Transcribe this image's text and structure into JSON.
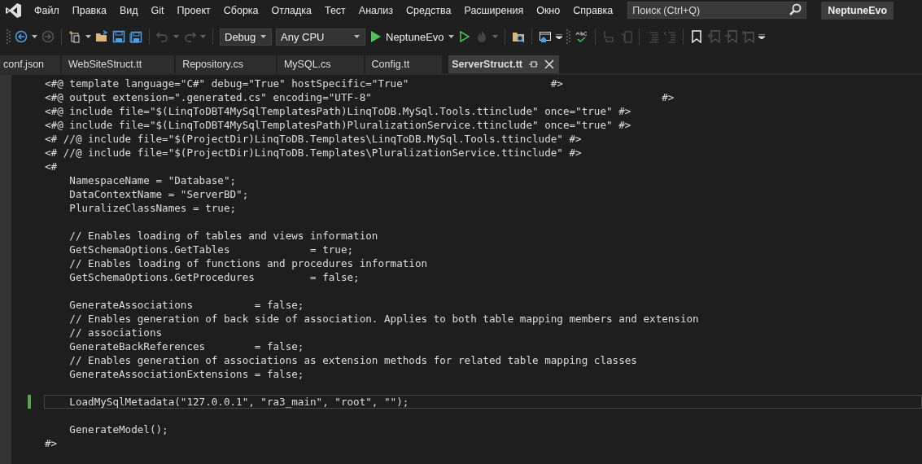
{
  "menu_bar": {
    "items": [
      "Файл",
      "Правка",
      "Вид",
      "Git",
      "Проект",
      "Сборка",
      "Отладка",
      "Тест",
      "Анализ",
      "Средства",
      "Расширения",
      "Окно",
      "Справка"
    ],
    "search": {
      "placeholder": "Поиск (Ctrl+Q)"
    },
    "solution_name": "NeptuneEvo"
  },
  "toolbar": {
    "configuration": "Debug",
    "platform": "Any CPU",
    "start_target": "NeptuneEvo"
  },
  "tabs": [
    {
      "label": "conf.json",
      "selected": false
    },
    {
      "label": "WebSiteStruct.tt",
      "selected": false
    },
    {
      "label": "Repository.cs",
      "selected": false
    },
    {
      "label": "MySQL.cs",
      "selected": false
    },
    {
      "label": "Config.tt",
      "selected": false
    },
    {
      "label": "ServerStruct.tt",
      "selected": true
    }
  ],
  "editor": {
    "lines": [
      {
        "kind": "code",
        "text": "<#@ template language=\"C#\" debug=\"True\" hostSpecific=\"True\"                       #>",
        "changed": false,
        "current": false
      },
      {
        "kind": "code",
        "text": "<#@ output extension=\".generated.cs\" encoding=\"UTF-8\"                                               #>",
        "changed": false,
        "current": false
      },
      {
        "kind": "code",
        "text": "<#@ include file=\"$(LinqToDBT4MySqlTemplatesPath)LinqToDB.MySql.Tools.ttinclude\" once=\"true\" #>",
        "changed": false,
        "current": false
      },
      {
        "kind": "code",
        "text": "<#@ include file=\"$(LinqToDBT4MySqlTemplatesPath)PluralizationService.ttinclude\" once=\"true\" #>",
        "changed": false,
        "current": false
      },
      {
        "kind": "code",
        "text": "<# //@ include file=\"$(ProjectDir)LinqToDB.Templates\\LinqToDB.MySql.Tools.ttinclude\" #>",
        "changed": false,
        "current": false
      },
      {
        "kind": "code",
        "text": "<# //@ include file=\"$(ProjectDir)LinqToDB.Templates\\PluralizationService.ttinclude\" #>",
        "changed": false,
        "current": false
      },
      {
        "kind": "code",
        "text": "<#",
        "changed": false,
        "current": false
      },
      {
        "kind": "code",
        "text": "    NamespaceName = \"Database\";",
        "changed": false,
        "current": false
      },
      {
        "kind": "code",
        "text": "    DataContextName = \"ServerBD\";",
        "changed": false,
        "current": false
      },
      {
        "kind": "code",
        "text": "    PluralizeClassNames = true;",
        "changed": false,
        "current": false
      },
      {
        "kind": "blank",
        "changed": false,
        "current": false
      },
      {
        "kind": "code",
        "text": "    // Enables loading of tables and views information",
        "changed": false,
        "current": false
      },
      {
        "kind": "code",
        "text": "    GetSchemaOptions.GetTables             = true;",
        "changed": false,
        "current": false
      },
      {
        "kind": "code",
        "text": "    // Enables loading of functions and procedures information",
        "changed": false,
        "current": false
      },
      {
        "kind": "code",
        "text": "    GetSchemaOptions.GetProcedures         = false;",
        "changed": false,
        "current": false
      },
      {
        "kind": "blank",
        "changed": false,
        "current": false
      },
      {
        "kind": "code",
        "text": "    GenerateAssociations          = false;",
        "changed": false,
        "current": false
      },
      {
        "kind": "code",
        "text": "    // Enables generation of back side of association. Applies to both table mapping members and extension",
        "changed": false,
        "current": false
      },
      {
        "kind": "code",
        "text": "    // associations",
        "changed": false,
        "current": false
      },
      {
        "kind": "code",
        "text": "    GenerateBackReferences        = false;",
        "changed": false,
        "current": false
      },
      {
        "kind": "code",
        "text": "    // Enables generation of associations as extension methods for related table mapping classes",
        "changed": false,
        "current": false
      },
      {
        "kind": "code",
        "text": "    GenerateAssociationExtensions = false;",
        "changed": false,
        "current": false
      },
      {
        "kind": "blank",
        "changed": false,
        "current": false
      },
      {
        "kind": "code",
        "text": "    LoadMySqlMetadata(\"127.0.0.1\", \"ra3_main\", \"root\", \"\");",
        "changed": true,
        "current": true
      },
      {
        "kind": "blank",
        "changed": false,
        "current": false
      },
      {
        "kind": "code",
        "text": "    GenerateModel();",
        "changed": false,
        "current": false
      },
      {
        "kind": "code",
        "text": "#>",
        "changed": false,
        "current": false
      }
    ]
  }
}
